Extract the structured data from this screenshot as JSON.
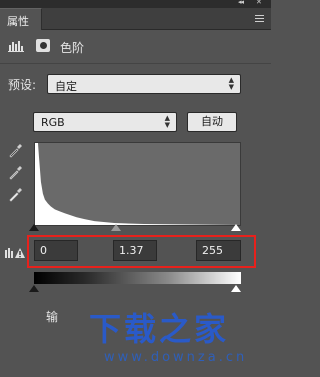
{
  "panel": {
    "tab_label": "属性",
    "collapse_glyph": "◂◂",
    "close_glyph": "✕"
  },
  "adjustment": {
    "title": "色阶"
  },
  "preset": {
    "label": "预设:",
    "value": "自定"
  },
  "channel": {
    "value": "RGB",
    "auto_label": "自动"
  },
  "input_levels": {
    "black": "0",
    "gamma": "1.37",
    "white": "255"
  },
  "output": {
    "label": "输"
  },
  "watermark": {
    "logo": "下载之家",
    "url": "www.downza.cn"
  },
  "colors": {
    "panel_bg": "#535353",
    "highlight_box": "#e8211c",
    "watermark": "#2a5ac8"
  }
}
